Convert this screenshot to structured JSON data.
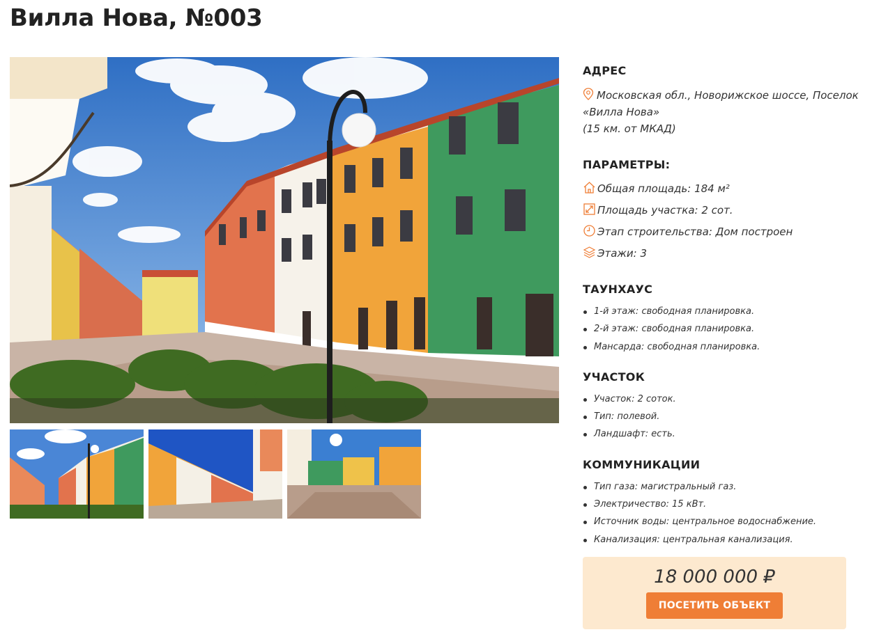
{
  "page": {
    "title": "Вилла Нова, №003"
  },
  "address": {
    "heading": "АДРЕС",
    "line1": "Московская обл., Новорижское шоссе, Поселок",
    "line2": "«Вилла Нова»",
    "line3": "(15 км. от МКАД)"
  },
  "params": {
    "heading": "ПАРАМЕТРЫ:",
    "items": [
      {
        "icon": "house-icon",
        "text": "Общая площадь: 184 м²"
      },
      {
        "icon": "resize-icon",
        "text": "Площадь участка: 2 сот."
      },
      {
        "icon": "clock-icon",
        "text": "Этап строительства: Дом построен"
      },
      {
        "icon": "layers-icon",
        "text": "Этажи: 3"
      }
    ]
  },
  "townhouse": {
    "heading": "ТАУНХАУС",
    "items": [
      "1-й этаж: свободная планировка.",
      "2-й этаж: свободная планировка.",
      "Мансарда: свободная планировка."
    ]
  },
  "plot": {
    "heading": "УЧАСТОК",
    "items": [
      "Участок: 2 соток.",
      "Тип: полевой.",
      "Ландшафт: есть."
    ]
  },
  "utilities": {
    "heading": "КОММУНИКАЦИИ",
    "items": [
      "Тип газа: магистральный газ.",
      "Электричество: 15 кВт.",
      "Источник воды: центральное водоснабжение.",
      "Канализация: центральная канализация."
    ]
  },
  "price": {
    "amount": "18 000 000 ₽",
    "button_label": "ПОСЕТИТЬ ОБЪЕКТ"
  },
  "colors": {
    "accent": "#ef7e36",
    "price_bg": "#fde9cf",
    "icon": "#ef7e36"
  }
}
